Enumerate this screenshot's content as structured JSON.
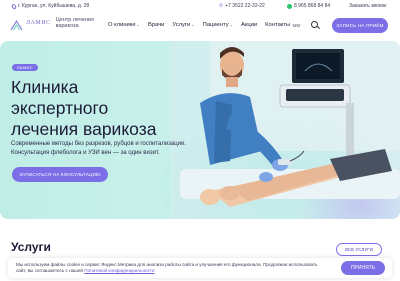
{
  "topbar": {
    "address": "г. Курган, ул. Куйбышева, д. 28",
    "phone_1": "+7 3522 22-32-22",
    "phone_2": "8 965 868 84 84",
    "callback": "Заказать звонок"
  },
  "header": {
    "logo_name": "ЛАМИС",
    "logo_sub_1": "Центр лечения",
    "logo_sub_2": "варикоза",
    "nav": [
      {
        "label": "О клинике",
        "dropdown": true
      },
      {
        "label": "Врачи",
        "dropdown": false
      },
      {
        "label": "Услуги",
        "dropdown": true
      },
      {
        "label": "Пациенту",
        "dropdown": true
      },
      {
        "label": "Акции",
        "dropdown": false
      },
      {
        "label": "Контакты",
        "dropdown": false
      }
    ],
    "appointment_button": "ЗАПИСЬ НА ПРИЁМ"
  },
  "hero": {
    "badge": "ЛАМИС",
    "title_line_1": "Клиника",
    "title_line_2": "экспертного",
    "title_line_3": "лечения варикоза",
    "lead_line_1": "Современные методы без разрезов, рубцов и госпитализации.",
    "lead_line_2": "Консультация флеболога и УЗИ вен — за один визит.",
    "cta": "ЗАПИСАТЬСЯ НА КОНСУЛЬТАЦИЮ"
  },
  "services": {
    "title": "Услуги",
    "all_button": "ВСЕ УСЛУГИ"
  },
  "cookie": {
    "text_1": "Мы используем файлы cookie и сервис Яндекс.Метрика для анализа работы сайта и улучшения его функционала. Продолжая использовать",
    "text_2": "сайт, вы соглашаетесь с нашей ",
    "link": "Политикой конфиденциальности",
    "accept": "ПРИНЯТЬ"
  },
  "icons": {
    "address": "map-pin-icon",
    "phone": "phone-icon",
    "whatsapp": "whatsapp-icon",
    "accessibility": "glasses-icon",
    "search": "search-icon"
  },
  "colors": {
    "accent": "#7b6ee6",
    "hero_bg": "#c8f0ea",
    "text": "#1c1c38"
  }
}
